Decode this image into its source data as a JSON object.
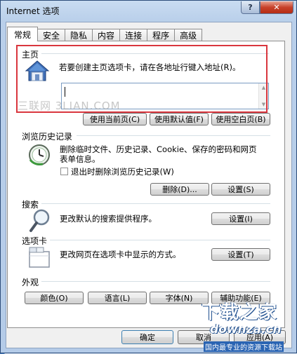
{
  "window": {
    "title": "Internet 选项",
    "help_label": "?",
    "close_label": "✕"
  },
  "tabs": [
    {
      "label": "常规",
      "active": true
    },
    {
      "label": "安全"
    },
    {
      "label": "隐私"
    },
    {
      "label": "内容"
    },
    {
      "label": "连接"
    },
    {
      "label": "程序"
    },
    {
      "label": "高级"
    }
  ],
  "homepage": {
    "group_label": "主页",
    "description": "若要创建主页选项卡，请在各地址行键入地址(R)。",
    "url_value": "",
    "buttons": {
      "use_current": "使用当前页(C)",
      "use_default": "使用默认值(F)",
      "use_blank": "使用空白页(B)"
    }
  },
  "history": {
    "group_label": "浏览历史记录",
    "description": "删除临时文件、历史记录、Cookie、保存的密码和网页表单信息。",
    "checkbox_label": "退出时删除浏览历史记录(W)",
    "checkbox_checked": false,
    "delete_button": "删除(D)...",
    "settings_button": "设置(S)"
  },
  "search": {
    "group_label": "搜索",
    "description": "更改默认的搜索提供程序。",
    "settings_button": "设置(I)"
  },
  "tabs_section": {
    "group_label": "选项卡",
    "description": "更改网页在选项卡中显示的方式。",
    "settings_button": "设置(T)"
  },
  "appearance": {
    "group_label": "外观",
    "buttons": {
      "colors": "颜色(O)",
      "languages": "语言(L)",
      "fonts": "字体(N)",
      "accessibility": "辅助功能(E)"
    }
  },
  "footer": {
    "ok_button": "确定",
    "cancel_button": "取消",
    "apply_button": "应用(A)"
  },
  "watermark_text": "三联网 3LIAN.COM",
  "logo": {
    "main": "下载之家",
    "url": "downza.cn",
    "sub": "国内最专业的资源下载站"
  },
  "colors": {
    "highlight_box": "#d9363e",
    "close_button": "#c7412a"
  }
}
